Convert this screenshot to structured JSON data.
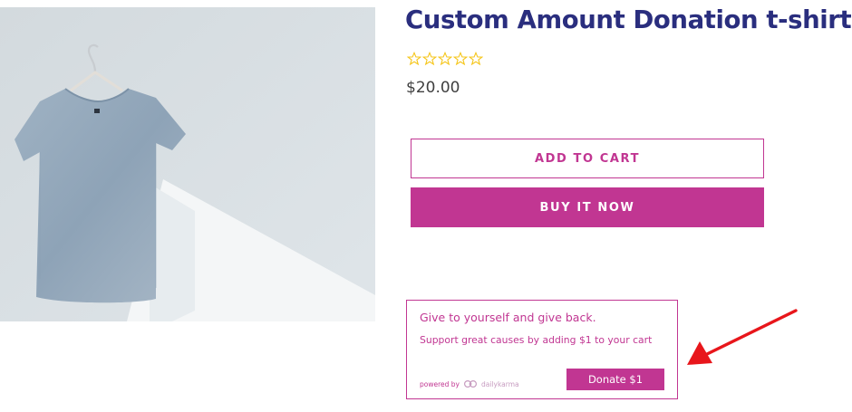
{
  "product": {
    "title": "Custom Amount Donation t-shirt",
    "price": "$20.00",
    "rating": 0,
    "rating_max": 5,
    "image_icon": "tshirt-on-hanger-photo"
  },
  "actions": {
    "add_to_cart": "ADD TO CART",
    "buy_now": "BUY IT NOW"
  },
  "donation": {
    "heading": "Give to yourself and give back.",
    "subtext": "Support great causes by adding $1 to your cart",
    "powered_by": "powered by",
    "brand": "dailykarma",
    "button": "Donate $1"
  },
  "colors": {
    "title": "#2a2e7e",
    "accent": "#c13692",
    "star": "#f5c518",
    "arrow": "#e8161b"
  }
}
